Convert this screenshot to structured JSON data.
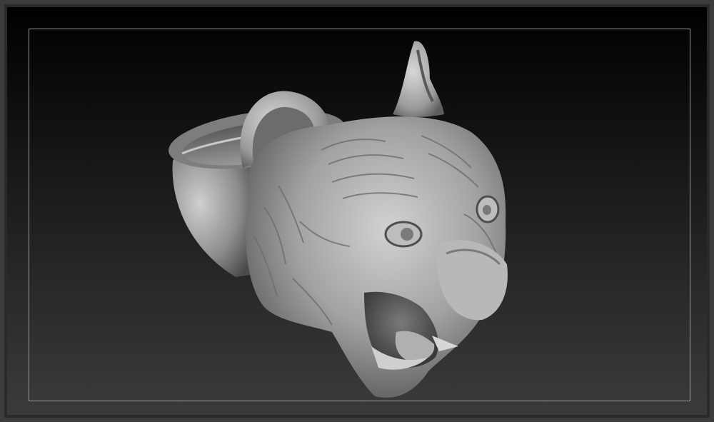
{
  "viewport": {
    "background_top": "#000000",
    "background_bottom": "#3b3b3b",
    "frame_guide_color": "#9a9a9a"
  },
  "model": {
    "subject": "tiger-head-ring",
    "material_color": "#a9a9a9"
  }
}
